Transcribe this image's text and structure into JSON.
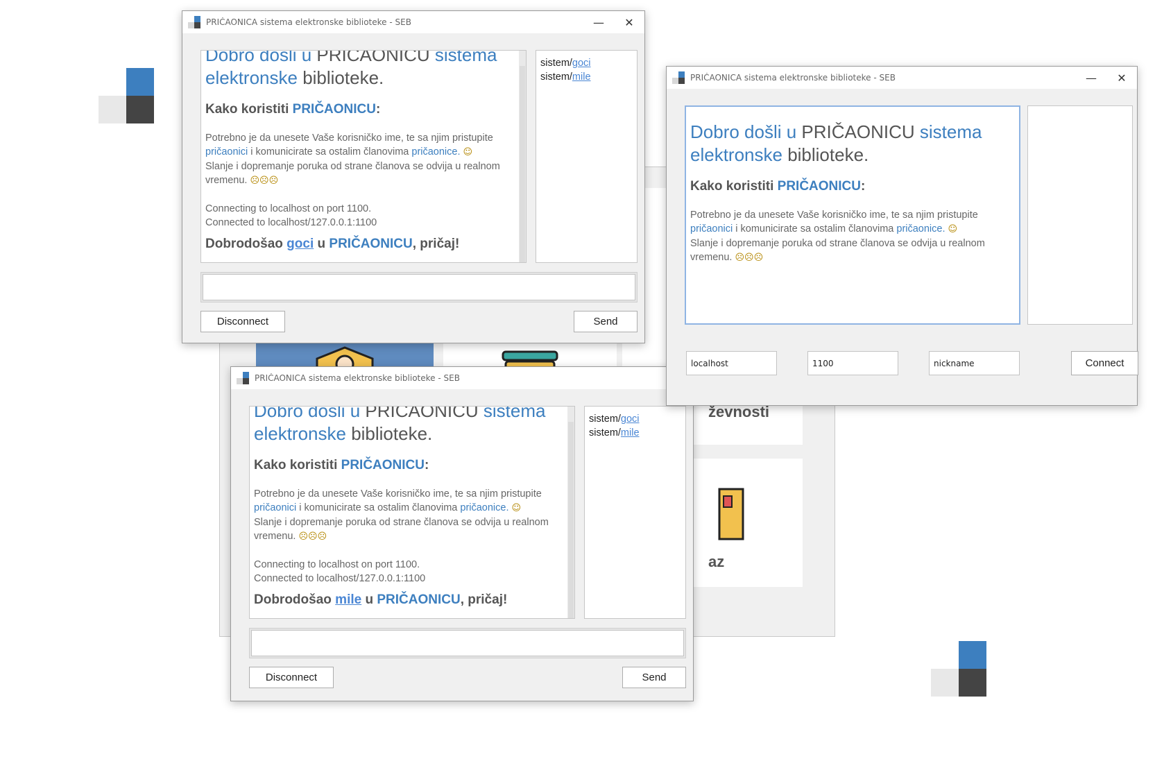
{
  "window_title": "PRIČAONICA sistema elektronske biblioteke - SEB",
  "controls": {
    "minimize": "—",
    "close": "✕"
  },
  "intro": {
    "h1_p1": "Dobro došli u ",
    "h1_p2": "PRIČAONICU ",
    "h1_p3": "sistema",
    "h1_p4": "elektronske ",
    "h1_p5": "biblioteke.",
    "h2_p1": "Kako koristiti ",
    "h2_p2": "PRIČAONICU",
    "h2_p3": ":",
    "p1_a": "Potrebno je da unesete Vaše korisničko ime, te sa njim pristupite",
    "p1_b": "pričaonici",
    "p1_c": " i komunicirate sa ostalim članovima ",
    "p1_d": "pričaonice.",
    "p2_a": "Slanje i dopremanje poruka od strane članova se odvija u realnom",
    "p2_b": "vremenu."
  },
  "emoji": {
    "wink": "☺",
    "faces": "☹☹☹"
  },
  "connecting": "Connecting to localhost on port 1100.",
  "connected": "Connected to localhost/127.0.0.1:1100",
  "welcome": {
    "p1": "Dobrodošao ",
    "p2": " u ",
    "p3": "PRIČAONICU",
    "p4": ", pričaj!",
    "user1": "goci",
    "user2": "mile"
  },
  "users": {
    "prefix": "sistem/",
    "list": [
      "goci",
      "mile"
    ]
  },
  "buttons": {
    "disconnect": "Disconnect",
    "send": "Send",
    "connect": "Connect"
  },
  "connect_form": {
    "host": "localhost",
    "port": "1100",
    "nickname": "nickname"
  },
  "background_app": {
    "label1": "ževnosti",
    "label2": "az"
  },
  "colors": {
    "accent": "#3d7fbf",
    "link": "#4a86d4",
    "dark": "#444444"
  }
}
